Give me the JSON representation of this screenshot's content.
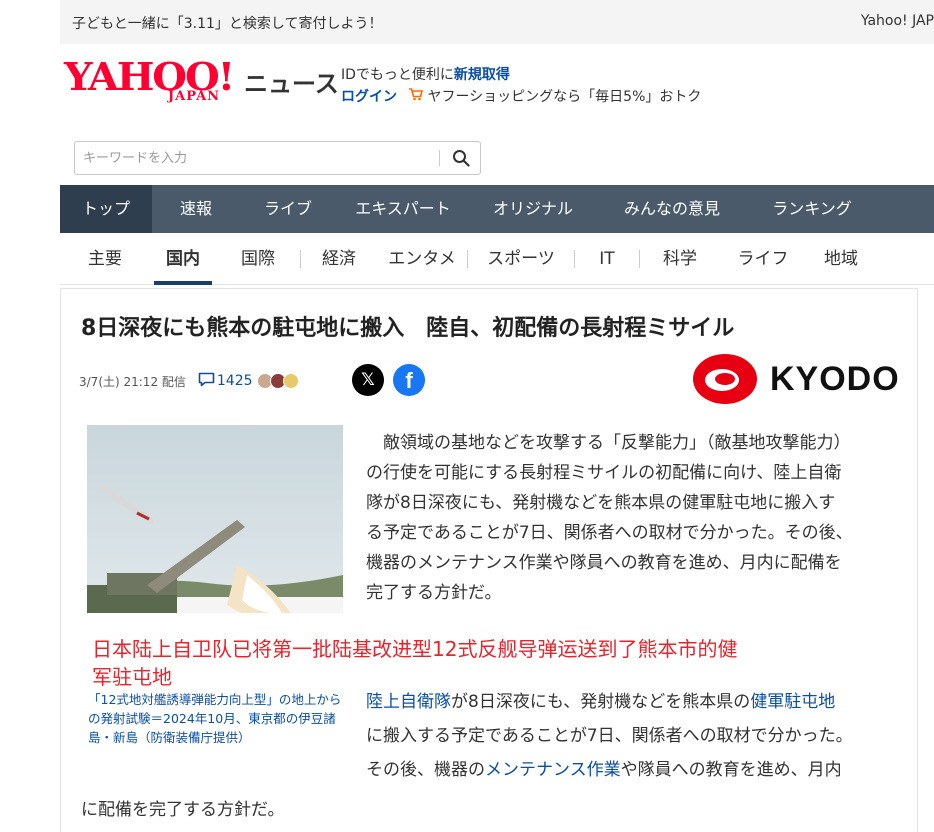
{
  "promo": {
    "text": "子どもと一緒に「3.11」と検索して寄付しよう！",
    "right": "Yahoo! JAP"
  },
  "logo": {
    "yahoo": "YAHOO!",
    "japan": "JAPAN",
    "news": "ニュース"
  },
  "header": {
    "id_prefix": "IDでもっと便利に",
    "register": "新規取得",
    "login": "ログイン",
    "shopping": "ヤフーショッピングなら「毎日5%」おトク"
  },
  "search": {
    "placeholder": "キーワードを入力"
  },
  "nav_main": [
    {
      "label": "トップ",
      "active": true
    },
    {
      "label": "速報"
    },
    {
      "label": "ライブ"
    },
    {
      "label": "エキスパート"
    },
    {
      "label": "オリジナル"
    },
    {
      "label": "みんなの意見"
    },
    {
      "label": "ランキング"
    }
  ],
  "nav_sub": [
    {
      "label": "主要"
    },
    {
      "label": "国内",
      "active": true
    },
    {
      "label": "国際"
    },
    {
      "label": "経済"
    },
    {
      "label": "エンタメ"
    },
    {
      "label": "スポーツ"
    },
    {
      "label": "IT"
    },
    {
      "label": "科学"
    },
    {
      "label": "ライフ"
    },
    {
      "label": "地域"
    }
  ],
  "article": {
    "headline": "8日深夜にも熊本の駐屯地に搬入　陸自、初配備の長射程ミサイル",
    "date": "3/7(土) 21:12 配信",
    "comment_count": "1425",
    "publisher": "KYODO",
    "body_lines": [
      "　敵領域の基地などを攻撃する「反撃能力」（敵基地攻撃能力）",
      "の行使を可能にする長射程ミサイルの初配備に向け、陸上自衛",
      "隊が8日深夜にも、発射機などを熊本県の健軍駐屯地に搬入す",
      "る予定であることが7日、関係者への取材で分かった。その後、",
      "機器のメンテナンス作業や隊員への教育を進め、月内に配備を",
      "完了する方針だ。"
    ],
    "overlay_caption_1": "日本陆上自卫队已将第一批陆基改进型12式反舰导弹运送到了熊本市的健",
    "overlay_caption_2": "军驻屯地",
    "photo_caption": "「12式地対艦誘導弾能力向上型」の地上からの発射試験＝2024年10月、東京都の伊豆諸島・新島（防衛装備庁提供）",
    "body2": {
      "link1": "陸上自衛隊",
      "part1": "が8日深夜にも、発射機などを熊本県の",
      "link2": "健軍駐屯地",
      "line2": "に搬入する予定であることが7日、関係者への取材で分かった。",
      "line3a": "その後、機器の",
      "link3": "メンテナンス作業",
      "line3b": "や隊員への教育を進め、月内",
      "line4": "に配備を完了する方針だ。"
    }
  },
  "colors": {
    "brand_red": "#ff0033",
    "nav_bg": "#4a5a6b",
    "nav_active": "#2f3e4f",
    "link_blue": "#0a4fa5",
    "overlay_red": "#e8232c",
    "kyodo_red": "#e60012"
  }
}
